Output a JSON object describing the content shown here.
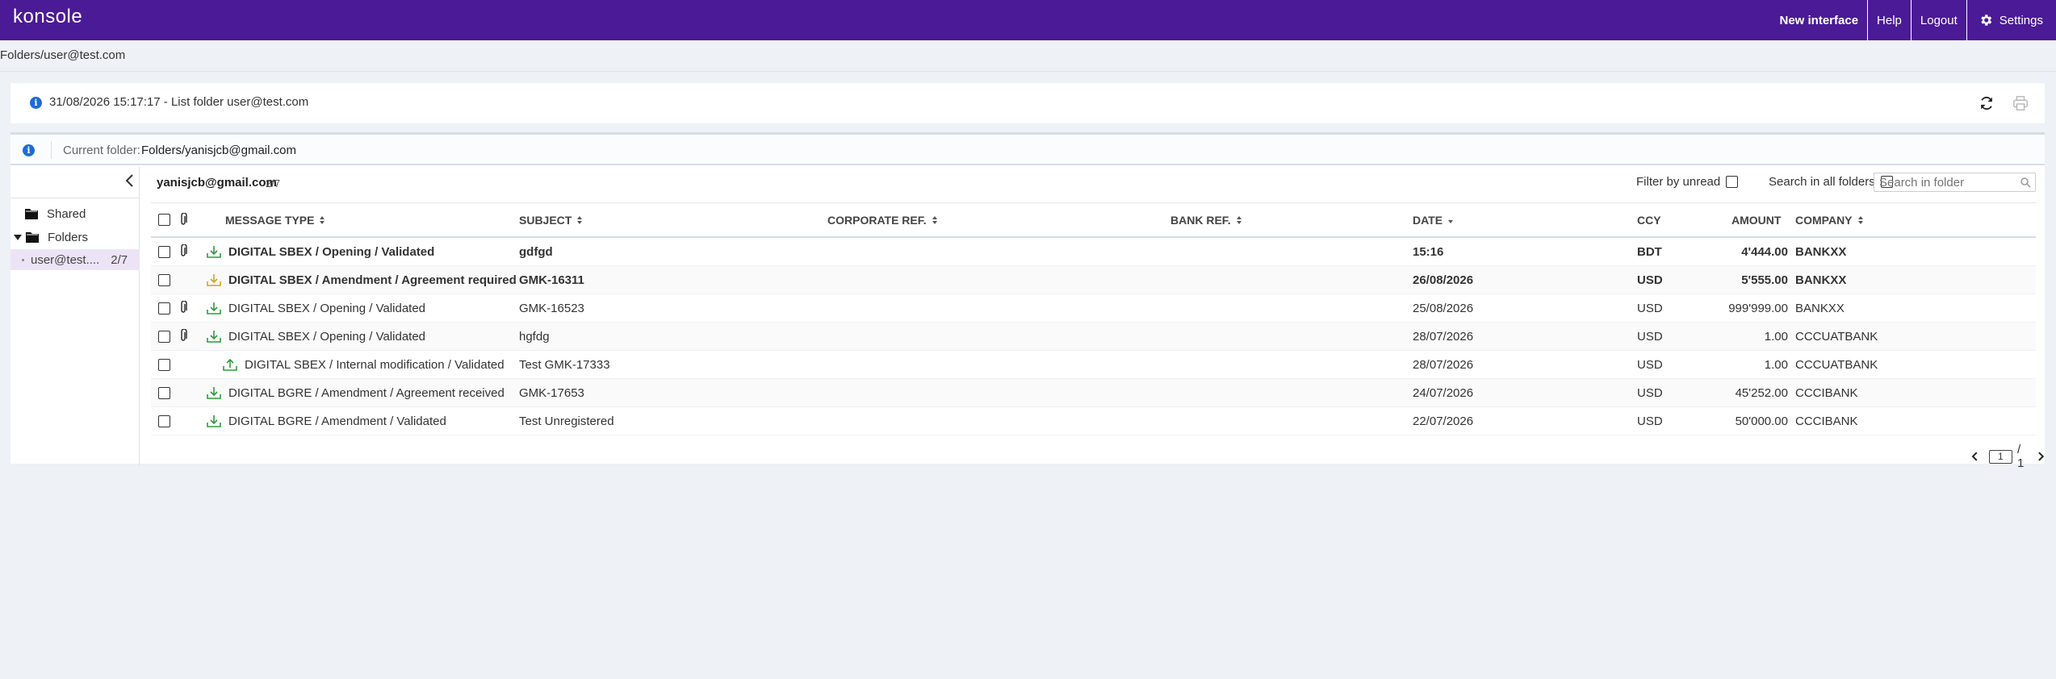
{
  "app": {
    "logo": "konsole"
  },
  "topnav": {
    "new_interface": "New interface",
    "help": "Help",
    "logout": "Logout",
    "settings": "Settings"
  },
  "breadcrumb": "Folders/user@test.com",
  "info": {
    "message": "31/08/2026 15:17:17 - List folder user@test.com"
  },
  "current_folder": {
    "label": "Current folder:",
    "value": "Folders/yanisjcb@gmail.com"
  },
  "sidebar": {
    "shared": "Shared",
    "folders": "Folders",
    "user_item": {
      "name": "user@test....",
      "count": "2/7"
    }
  },
  "content": {
    "account": "yanisjcb@gmail.com",
    "account_count": "2/7",
    "filter_unread": "Filter by unread",
    "search_all": "Search in all folders",
    "search_placeholder": "Search in folder"
  },
  "table": {
    "headers": {
      "message_type": "MESSAGE TYPE",
      "subject": "SUBJECT",
      "corporate_ref": "CORPORATE REF.",
      "bank_ref": "BANK REF.",
      "date": "DATE",
      "ccy": "CCY",
      "amount": "AMOUNT",
      "company": "COMPANY"
    },
    "rows": [
      {
        "attach": true,
        "icon": "download-green",
        "message_type": "DIGITAL SBEX / Opening / Validated",
        "subject": "gdfgd",
        "corporate_ref": "",
        "bank_ref": "",
        "date": "15:16",
        "ccy": "BDT",
        "amount": "4'444.00",
        "company": "BANKXX",
        "unread": true,
        "indent": false
      },
      {
        "attach": false,
        "icon": "download-yellow",
        "message_type": "DIGITAL SBEX / Amendment / Agreement required",
        "subject": "GMK-16311",
        "corporate_ref": "",
        "bank_ref": "",
        "date": "26/08/2026",
        "ccy": "USD",
        "amount": "5'555.00",
        "company": "BANKXX",
        "unread": true,
        "indent": false
      },
      {
        "attach": true,
        "icon": "download-green",
        "message_type": "DIGITAL SBEX / Opening / Validated",
        "subject": "GMK-16523",
        "corporate_ref": "",
        "bank_ref": "",
        "date": "25/08/2026",
        "ccy": "USD",
        "amount": "999'999.00",
        "company": "BANKXX",
        "unread": false,
        "indent": false
      },
      {
        "attach": true,
        "icon": "download-green",
        "message_type": "DIGITAL SBEX / Opening / Validated",
        "subject": "hgfdg",
        "corporate_ref": "",
        "bank_ref": "",
        "date": "28/07/2026",
        "ccy": "USD",
        "amount": "1.00",
        "company": "CCCUATBANK",
        "unread": false,
        "indent": false
      },
      {
        "attach": false,
        "icon": "upload-green",
        "message_type": "DIGITAL SBEX / Internal modification / Validated",
        "subject": "Test GMK-17333",
        "corporate_ref": "",
        "bank_ref": "",
        "date": "28/07/2026",
        "ccy": "USD",
        "amount": "1.00",
        "company": "CCCUATBANK",
        "unread": false,
        "indent": true
      },
      {
        "attach": false,
        "icon": "download-green",
        "message_type": "DIGITAL BGRE / Amendment / Agreement received",
        "subject": "GMK-17653",
        "corporate_ref": "",
        "bank_ref": "",
        "date": "24/07/2026",
        "ccy": "USD",
        "amount": "45'252.00",
        "company": "CCCIBANK",
        "unread": false,
        "indent": false
      },
      {
        "attach": false,
        "icon": "download-green",
        "message_type": "DIGITAL BGRE / Amendment / Validated",
        "subject": "Test Unregistered",
        "corporate_ref": "",
        "bank_ref": "",
        "date": "22/07/2026",
        "ccy": "USD",
        "amount": "50'000.00",
        "company": "CCCIBANK",
        "unread": false,
        "indent": false
      }
    ]
  },
  "pager": {
    "page": "1",
    "total": "/ 1"
  },
  "colors": {
    "topbar": "#4b1a96",
    "info_blue": "#1e6bd6",
    "icon_green": "#2e9d3a",
    "icon_yellow": "#d9a21b",
    "selected_bg": "#ece4f6"
  }
}
